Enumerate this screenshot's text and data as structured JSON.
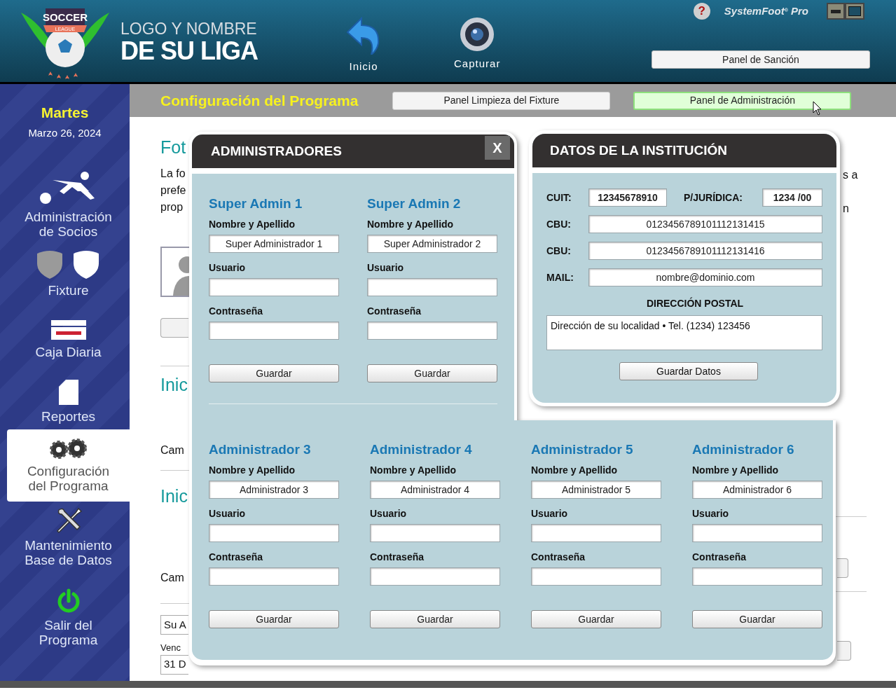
{
  "header": {
    "logo_line1": "LOGO Y NOMBRE",
    "logo_line2": "DE SU LIGA",
    "logo_badge": "SOCCER",
    "logo_ribbon": "LEAGUE",
    "tools": [
      {
        "label": "Inicio",
        "kind": "home"
      },
      {
        "label": "Capturar",
        "kind": "camera"
      }
    ],
    "help": "?",
    "brand": "SystemFoot",
    "brand_mark": "®",
    "brand_suffix": "Pro",
    "sanction_button": "Panel de Sanción"
  },
  "sidebar": {
    "day": "Martes",
    "date": "Marzo 26, 2024",
    "items": [
      {
        "label": "Administración de Socios",
        "kind": "player",
        "selected": false
      },
      {
        "label": "Fixture",
        "kind": "shields",
        "selected": false
      },
      {
        "label": "Caja Diaria",
        "kind": "box",
        "selected": false
      },
      {
        "label": "Reportes",
        "kind": "document",
        "selected": false
      },
      {
        "label": "Configuración del Programa",
        "kind": "gears",
        "selected": true
      },
      {
        "label": "Mantenimiento Base de Datos",
        "kind": "tools",
        "selected": false
      },
      {
        "label": "Salir del Programa",
        "kind": "power",
        "selected": false
      }
    ]
  },
  "toolbar": {
    "title": "Configuración del Programa",
    "buttons": [
      {
        "label": "Panel Limpieza del Fixture",
        "selected": false
      },
      {
        "label": "Panel de Administración",
        "selected": true
      }
    ]
  },
  "background": {
    "heading": "Fot",
    "para_lines": [
      "La fo",
      "prefe",
      "prop"
    ],
    "right_lines": [
      "s a",
      "n"
    ],
    "section_1": "Inic",
    "label_1": "Cam",
    "section_2": "Inic",
    "label_2": "Cam",
    "field_1": "Su A",
    "caption": "Venc",
    "field_2": "31 D"
  },
  "admins_panel": {
    "title": "ADMINISTRADORES",
    "close": "X",
    "admins": [
      {
        "title": "Super Admin 1",
        "name_label": "Nombre y Apellido",
        "name": "Super Administrador 1",
        "user_label": "Usuario",
        "password_label": "Contraseña",
        "button": "Guardar"
      },
      {
        "title": "Super Admin 2",
        "name_label": "Nombre y Apellido",
        "name": "Super Administrador 2",
        "user_label": "Usuario",
        "password_label": "Contraseña",
        "button": "Guardar"
      },
      {
        "title": "Administrador 3",
        "name_label": "Nombre y Apellido",
        "name": "Administrador 3",
        "user_label": "Usuario",
        "password_label": "Contraseña",
        "button": "Guardar"
      },
      {
        "title": "Administrador 4",
        "name_label": "Nombre y Apellido",
        "name": "Administrador 4",
        "user_label": "Usuario",
        "password_label": "Contraseña",
        "button": "Guardar"
      },
      {
        "title": "Administrador 5",
        "name_label": "Nombre y Apellido",
        "name": "Administrador 5",
        "user_label": "Usuario",
        "password_label": "Contraseña",
        "button": "Guardar"
      },
      {
        "title": "Administrador 6",
        "name_label": "Nombre y Apellido",
        "name": "Administrador 6",
        "user_label": "Usuario",
        "password_label": "Contraseña",
        "button": "Guardar"
      }
    ]
  },
  "institution_panel": {
    "title": "DATOS DE LA INSTITUCIÓN",
    "cuit_label": "CUIT:",
    "cuit": "12345678910",
    "pj_label": "P/JURÍDICA:",
    "pj": "1234 /00",
    "rows": [
      {
        "label": "CBU:",
        "value": "0123456789101112131415"
      },
      {
        "label": "CBU:",
        "value": "0123456789101112131416"
      },
      {
        "label": "MAIL:",
        "value": "nombre@dominio.com"
      }
    ],
    "address_heading": "DIRECCIÓN POSTAL",
    "address": "Dirección de su localidad • Tel. (1234)  123456",
    "button": "Guardar Datos"
  }
}
